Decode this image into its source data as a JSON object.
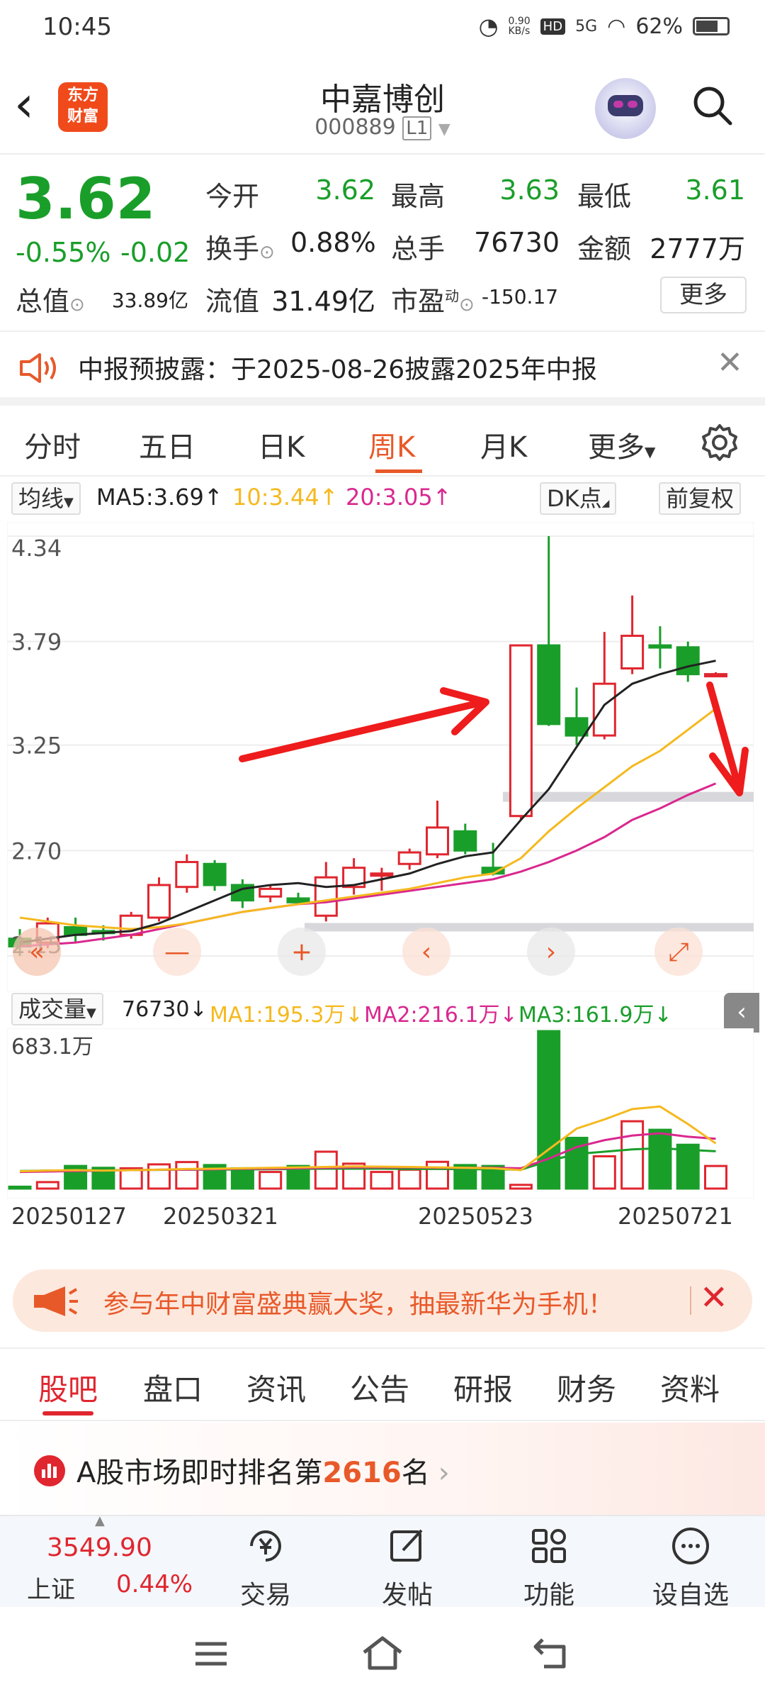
{
  "status_bar": {
    "time": "10:45",
    "net_speed": "0.90\nKB/s",
    "hd": "HD",
    "network": "5G",
    "battery": "62%"
  },
  "header": {
    "logo_text": "东方财富",
    "stock_name": "中嘉博创",
    "stock_code": "000889",
    "level": "L1"
  },
  "quote": {
    "price": "3.62",
    "change_pct": "-0.55%",
    "change": "-0.02",
    "open_label": "今开",
    "open": "3.62",
    "high_label": "最高",
    "high": "3.63",
    "low_label": "最低",
    "low": "3.61",
    "turnover_label": "换手",
    "turnover": "0.88%",
    "volume_label": "总手",
    "volume": "76730",
    "amount_label": "金额",
    "amount": "2777万",
    "mcap_label": "总值",
    "mcap": "33.89亿",
    "float_label": "流值",
    "float": "31.49亿",
    "pe_label": "市盈",
    "pe_sup": "动",
    "pe": "-150.17",
    "more": "更多"
  },
  "notice": {
    "text": "中报预披露：于2025-08-26披露2025年中报"
  },
  "ktabs": [
    "分时",
    "五日",
    "日K",
    "周K",
    "月K",
    "更多"
  ],
  "ma_row": {
    "selector": "均线",
    "ma5": "MA5:3.69↑",
    "ma10": "10:3.44↑",
    "ma20": "20:3.05↑",
    "dk": "DK点",
    "fq": "前复权"
  },
  "colors": {
    "up": "#e0262f",
    "down": "#1a9e2a",
    "ma5": "#222222",
    "ma10": "#f5b91e",
    "ma20": "#d9288f",
    "accent": "#e8592a"
  },
  "chart_data": [
    {
      "type": "candlestick",
      "y_labels": [
        "4.34",
        "3.79",
        "3.25",
        "2.70",
        "2.15"
      ],
      "ylim": [
        2.15,
        4.34
      ],
      "candles": [
        {
          "o": 2.24,
          "c": 2.2,
          "h": 2.29,
          "l": 2.15
        },
        {
          "o": 2.22,
          "c": 2.32,
          "h": 2.35,
          "l": 2.19
        },
        {
          "o": 2.3,
          "c": 2.26,
          "h": 2.35,
          "l": 2.22
        },
        {
          "o": 2.28,
          "c": 2.27,
          "h": 2.31,
          "l": 2.23
        },
        {
          "o": 2.26,
          "c": 2.36,
          "h": 2.38,
          "l": 2.24
        },
        {
          "o": 2.35,
          "c": 2.52,
          "h": 2.56,
          "l": 2.33
        },
        {
          "o": 2.51,
          "c": 2.64,
          "h": 2.68,
          "l": 2.48
        },
        {
          "o": 2.63,
          "c": 2.52,
          "h": 2.65,
          "l": 2.49
        },
        {
          "o": 2.52,
          "c": 2.44,
          "h": 2.55,
          "l": 2.4
        },
        {
          "o": 2.46,
          "c": 2.5,
          "h": 2.52,
          "l": 2.43
        },
        {
          "o": 2.45,
          "c": 2.43,
          "h": 2.48,
          "l": 2.42
        },
        {
          "o": 2.36,
          "c": 2.56,
          "h": 2.64,
          "l": 2.33
        },
        {
          "o": 2.51,
          "c": 2.61,
          "h": 2.66,
          "l": 2.47
        },
        {
          "o": 2.58,
          "c": 2.58,
          "h": 2.61,
          "l": 2.49
        },
        {
          "o": 2.63,
          "c": 2.69,
          "h": 2.71,
          "l": 2.6
        },
        {
          "o": 2.68,
          "c": 2.82,
          "h": 2.96,
          "l": 2.66
        },
        {
          "o": 2.8,
          "c": 2.7,
          "h": 2.84,
          "l": 2.68
        },
        {
          "o": 2.61,
          "c": 2.58,
          "h": 2.74,
          "l": 2.57
        },
        {
          "o": 2.88,
          "c": 3.77,
          "h": 3.77,
          "l": 2.86
        },
        {
          "o": 3.77,
          "c": 3.36,
          "h": 4.34,
          "l": 3.35
        },
        {
          "o": 3.39,
          "c": 3.3,
          "h": 3.55,
          "l": 3.25
        },
        {
          "o": 3.3,
          "c": 3.57,
          "h": 3.84,
          "l": 3.28
        },
        {
          "o": 3.65,
          "c": 3.82,
          "h": 4.03,
          "l": 3.62
        },
        {
          "o": 3.77,
          "c": 3.76,
          "h": 3.87,
          "l": 3.65
        },
        {
          "o": 3.76,
          "c": 3.62,
          "h": 3.79,
          "l": 3.58
        },
        {
          "o": 3.62,
          "c": 3.62,
          "h": 3.63,
          "l": 3.61
        }
      ],
      "ma5": [
        2.22,
        2.24,
        2.26,
        2.27,
        2.28,
        2.32,
        2.38,
        2.44,
        2.5,
        2.52,
        2.53,
        2.51,
        2.52,
        2.55,
        2.58,
        2.63,
        2.67,
        2.69,
        2.86,
        3.02,
        3.24,
        3.46,
        3.57,
        3.62,
        3.66,
        3.69
      ],
      "ma10": [
        2.35,
        2.33,
        2.31,
        2.3,
        2.29,
        2.3,
        2.32,
        2.35,
        2.38,
        2.4,
        2.42,
        2.44,
        2.46,
        2.48,
        2.5,
        2.53,
        2.56,
        2.58,
        2.66,
        2.8,
        2.92,
        3.03,
        3.14,
        3.22,
        3.33,
        3.44
      ],
      "ma20": [
        2.2,
        2.21,
        2.22,
        2.24,
        2.26,
        2.29,
        2.32,
        2.35,
        2.38,
        2.4,
        2.42,
        2.43,
        2.45,
        2.47,
        2.49,
        2.51,
        2.53,
        2.55,
        2.59,
        2.64,
        2.7,
        2.77,
        2.86,
        2.92,
        2.99,
        3.05
      ]
    },
    {
      "type": "bar",
      "title": "成交量",
      "ymax_label": "683.1万",
      "ylim": [
        0,
        683.1
      ],
      "values": [
        8,
        28,
        98,
        90,
        88,
        105,
        115,
        102,
        88,
        72,
        98,
        160,
        108,
        72,
        82,
        116,
        102,
        98,
        16,
        683,
        220,
        140,
        292,
        255,
        190,
        98
      ],
      "ma1": [
        75,
        78,
        80,
        78,
        80,
        82,
        85,
        86,
        88,
        90,
        92,
        94,
        96,
        95,
        94,
        92,
        90,
        88,
        80,
        170,
        260,
        300,
        345,
        356,
        280,
        196
      ],
      "ma2": [
        72,
        74,
        76,
        78,
        80,
        82,
        82,
        84,
        86,
        86,
        88,
        90,
        92,
        92,
        92,
        90,
        90,
        90,
        88,
        130,
        180,
        210,
        230,
        240,
        225,
        216
      ],
      "ma3": [
        76,
        78,
        79,
        80,
        80,
        81,
        82,
        82,
        83,
        84,
        85,
        86,
        86,
        86,
        85,
        85,
        84,
        84,
        82,
        120,
        150,
        160,
        170,
        175,
        168,
        162
      ]
    }
  ],
  "x_dates": [
    "20250127",
    "20250321",
    "20250523",
    "20250721"
  ],
  "vol_row": {
    "selector": "成交量",
    "vol": "76730↓",
    "ma1": "MA1:195.3万↓",
    "ma2": "MA2:216.1万↓",
    "ma3": "MA3:161.9万↓"
  },
  "banner": {
    "text": "参与年中财富盛典赢大奖，抽最新华为手机！"
  },
  "bottom_tabs": [
    "股吧",
    "盘口",
    "资讯",
    "公告",
    "研报",
    "财务",
    "资料"
  ],
  "rank": {
    "prefix": "A股市场即时排名第",
    "number": "2616",
    "suffix": "名"
  },
  "footer": {
    "index_value": "3549.90",
    "index_name": "上证",
    "index_change": "0.44%",
    "items": [
      "交易",
      "发帖",
      "功能",
      "设自选"
    ]
  }
}
